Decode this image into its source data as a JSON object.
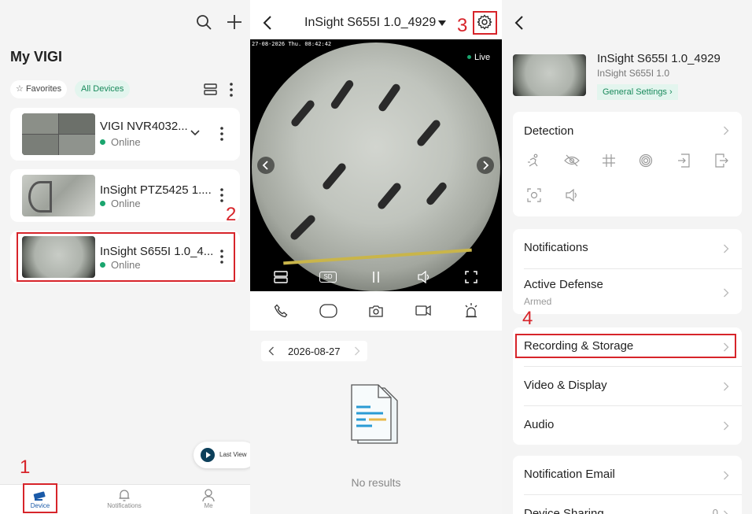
{
  "left_panel": {
    "title": "My VIGI",
    "filters": {
      "favorites": "Favorites",
      "all_devices": "All Devices"
    },
    "devices": [
      {
        "name": "VIGI NVR4032...",
        "status": "Online"
      },
      {
        "name": "InSight PTZ5425 1....",
        "status": "Online"
      },
      {
        "name": "InSight S655I 1.0_4...",
        "status": "Online"
      }
    ],
    "last_view": "Last View",
    "bottom_nav": [
      {
        "label": "Device",
        "icon": "camera-icon"
      },
      {
        "label": "Notifications",
        "icon": "bell-icon"
      },
      {
        "label": "Me",
        "icon": "person-icon"
      }
    ]
  },
  "middle_panel": {
    "header_title": "InSight S655I 1.0_4929",
    "video": {
      "osd_timestamp": "27-08-2026 Thu. 08:42:42",
      "live_label": "Live",
      "quality": "SD"
    },
    "controls": [
      "phone-icon",
      "screen-icon",
      "snapshot-icon",
      "record-icon",
      "alarm-icon"
    ],
    "date": "2026-08-27",
    "empty_text": "No results"
  },
  "right_panel": {
    "device_name": "InSight S655I 1.0_4929",
    "model": "InSight S655I 1.0",
    "general_settings": "General Settings",
    "detection": "Detection",
    "detection_icons": [
      "motion-icon",
      "tamper-icon",
      "line-crossing-icon",
      "intrusion-icon",
      "enter-area-icon",
      "exit-area-icon",
      "face-icon",
      "sound-icon"
    ],
    "notifications": "Notifications",
    "active_defense": "Active Defense",
    "active_defense_status": "Armed",
    "recording_storage": "Recording & Storage",
    "video_display": "Video & Display",
    "audio": "Audio",
    "notification_email": "Notification Email",
    "device_sharing": "Device Sharing",
    "device_sharing_count": "0"
  },
  "step_labels": [
    "1",
    "2",
    "3",
    "4"
  ],
  "colors": {
    "accent": "#1aa56e",
    "highlight": "#d7242a",
    "teal_bg": "#e3f5ee"
  }
}
